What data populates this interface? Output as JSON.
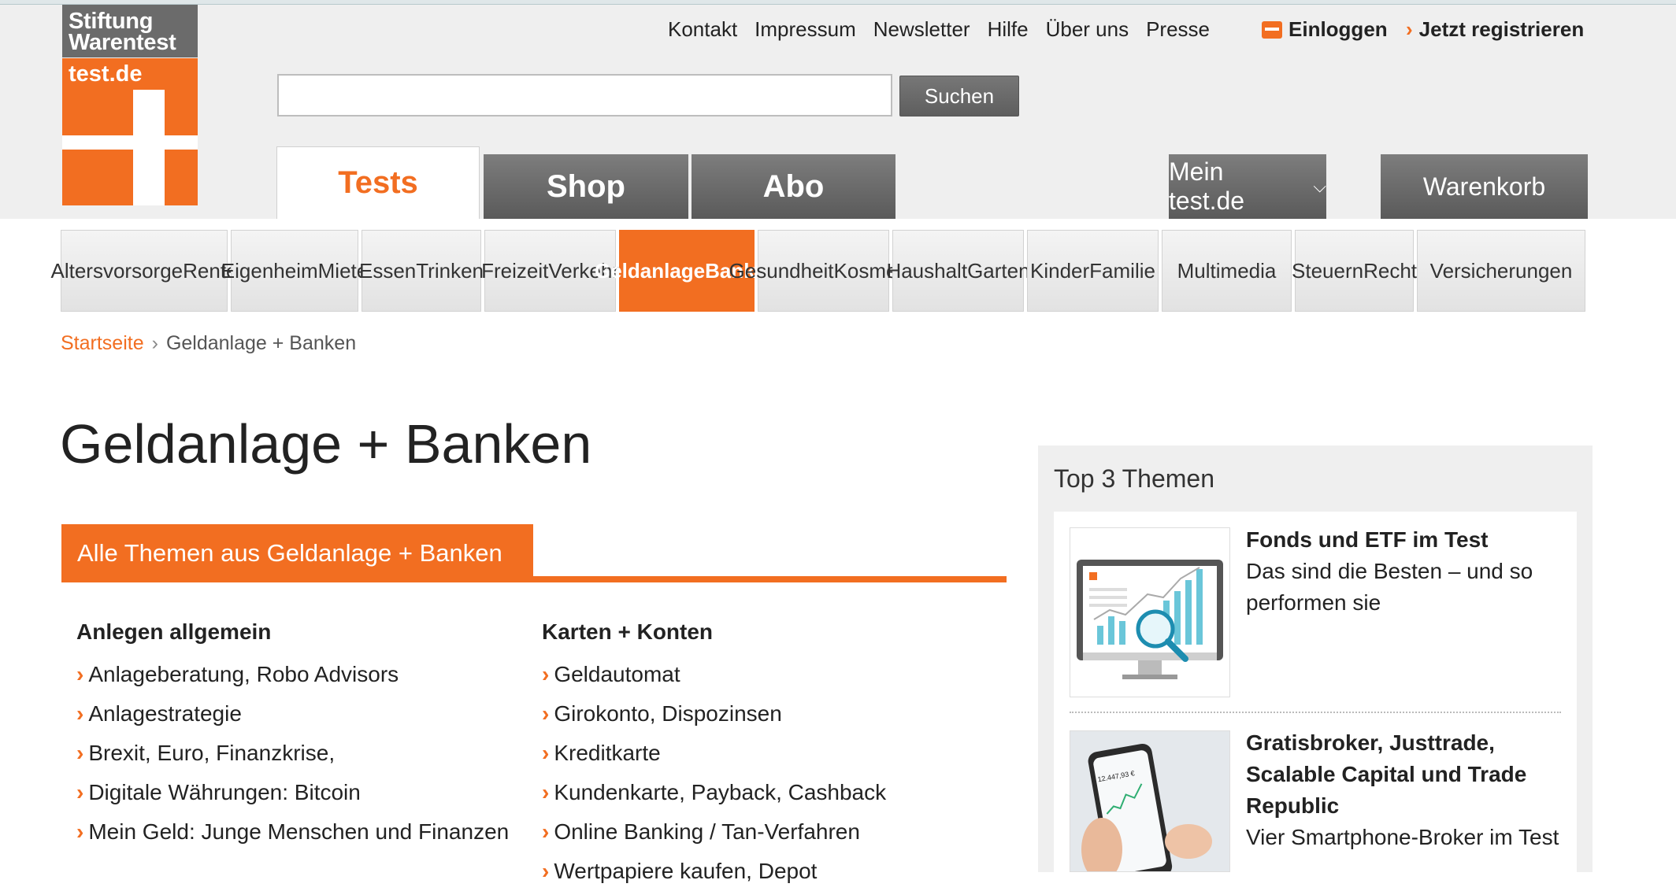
{
  "logo": {
    "line1": "Stiftung",
    "line2": "Warentest",
    "site": "test.de"
  },
  "toplinks": [
    "Kontakt",
    "Impressum",
    "Newsletter",
    "Hilfe",
    "Über uns",
    "Presse"
  ],
  "account": {
    "login": "Einloggen",
    "register": "Jetzt registrieren"
  },
  "search": {
    "value": "",
    "button": "Suchen"
  },
  "tabs": [
    "Tests",
    "Shop",
    "Abo"
  ],
  "right_tabs": {
    "mein": "Mein test.de",
    "cart": "Warenkorb"
  },
  "categories": [
    [
      "Altersvorsorge",
      "Rente"
    ],
    [
      "Eigenheim",
      "Miete"
    ],
    [
      "Essen",
      "Trinken"
    ],
    [
      "Freizeit",
      "Verkehr"
    ],
    [
      "Geldanlage",
      "Banken"
    ],
    [
      "Gesundheit",
      "Kosmetik"
    ],
    [
      "Haushalt",
      "Garten"
    ],
    [
      "Kinder",
      "Familie"
    ],
    [
      "Multimedia"
    ],
    [
      "Steuern",
      "Recht"
    ],
    [
      "Versicherungen"
    ]
  ],
  "breadcrumb": {
    "home": "Startseite",
    "current": "Geldanlage + Banken"
  },
  "page_title": "Geldanlage + Banken",
  "themes_tab": "Alle Themen aus Geldanlage + Banken",
  "columns": [
    {
      "heading": "Anlegen allgemein",
      "items": [
        "Anlageberatung, Robo Advisors",
        "Anlagestrategie",
        "Brexit, Euro, Finanzkrise,",
        "Digitale Währungen: Bitcoin",
        "Mein Geld: Junge Menschen und Finanzen"
      ]
    },
    {
      "heading": "Karten + Konten",
      "items": [
        "Geldautomat",
        "Girokonto, Dispozinsen",
        "Kreditkarte",
        "Kundenkarte, Payback, Cashback",
        "Online Banking / Tan-Verfahren",
        "Wertpapiere kaufen, Depot"
      ]
    }
  ],
  "sidebar": {
    "title": "Top 3 Themen",
    "cards": [
      {
        "title": "Fonds und ETF im Test",
        "subtitle": "Das sind die Besten – und so performen sie"
      },
      {
        "title": "Gratisbroker, Justtrade, Scalable Capital und Trade Republic",
        "subtitle": "Vier Smartphone-Broker im Test"
      }
    ],
    "phone_value": "12.447,93 €"
  }
}
